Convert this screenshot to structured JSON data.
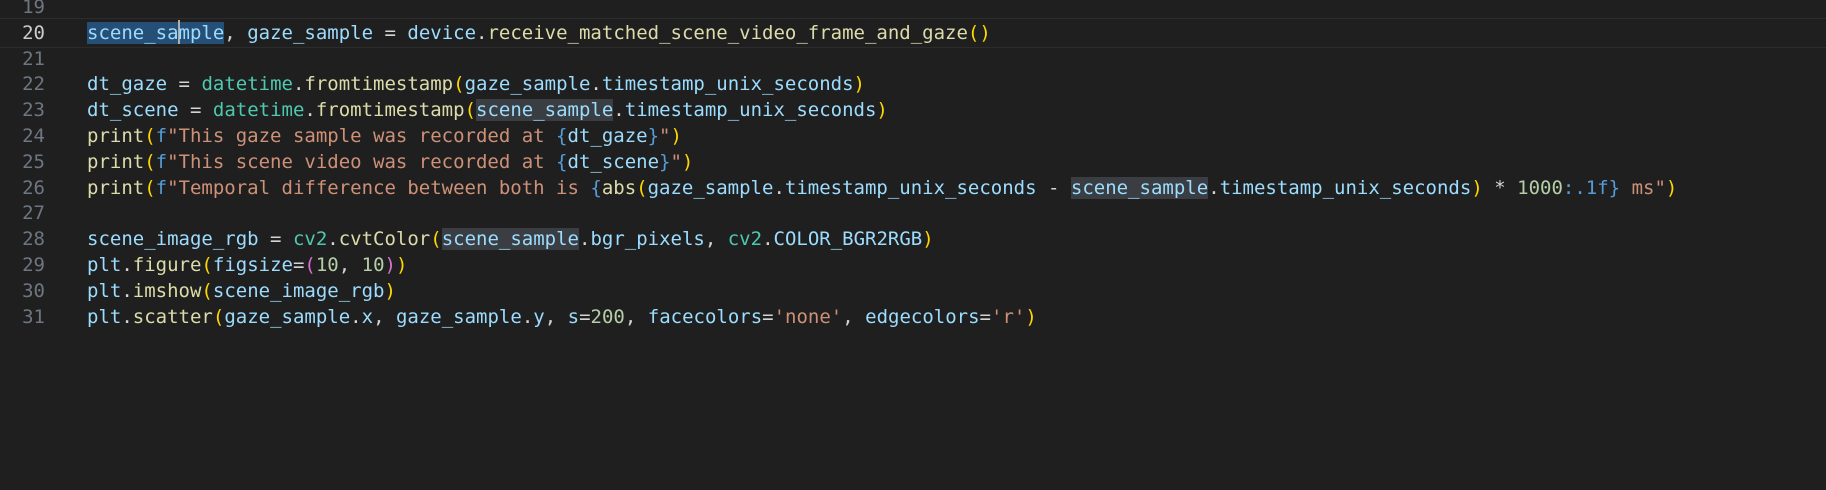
{
  "editor": {
    "language": "python",
    "current_line": "20",
    "lines": [
      {
        "number": "19",
        "text": ""
      },
      {
        "number": "20",
        "text": "scene_sample, gaze_sample = device.receive_matched_scene_video_frame_and_gaze()"
      },
      {
        "number": "21",
        "text": ""
      },
      {
        "number": "22",
        "text": "dt_gaze = datetime.fromtimestamp(gaze_sample.timestamp_unix_seconds)"
      },
      {
        "number": "23",
        "text": "dt_scene = datetime.fromtimestamp(scene_sample.timestamp_unix_seconds)"
      },
      {
        "number": "24",
        "text": "print(f\"This gaze sample was recorded at {dt_gaze}\")"
      },
      {
        "number": "25",
        "text": "print(f\"This scene video was recorded at {dt_scene}\")"
      },
      {
        "number": "26",
        "text": "print(f\"Temporal difference between both is {abs(gaze_sample.timestamp_unix_seconds - scene_sample.timestamp_unix_seconds) * 1000:.1f} ms\")"
      },
      {
        "number": "27",
        "text": ""
      },
      {
        "number": "28",
        "text": "scene_image_rgb = cv2.cvtColor(scene_sample.bgr_pixels, cv2.COLOR_BGR2RGB)"
      },
      {
        "number": "29",
        "text": "plt.figure(figsize=(10, 10))"
      },
      {
        "number": "30",
        "text": "plt.imshow(scene_image_rgb)"
      },
      {
        "number": "31",
        "text": "plt.scatter(gaze_sample.x, gaze_sample.y, s=200, facecolors='none', edgecolors='r')"
      }
    ]
  },
  "theme": {
    "background": "#1f1f1f",
    "line_number": "#6e7681",
    "line_number_active": "#cccccc",
    "variable": "#9cdcfe",
    "function": "#dcdcaa",
    "class": "#4ec9b0",
    "string": "#ce9178",
    "number": "#b5cea8",
    "bracket_1": "#ffd700",
    "bracket_2": "#da70d6",
    "bracket_3": "#179fff",
    "selection": "#264f78",
    "word_highlight": "#3a3d41"
  }
}
